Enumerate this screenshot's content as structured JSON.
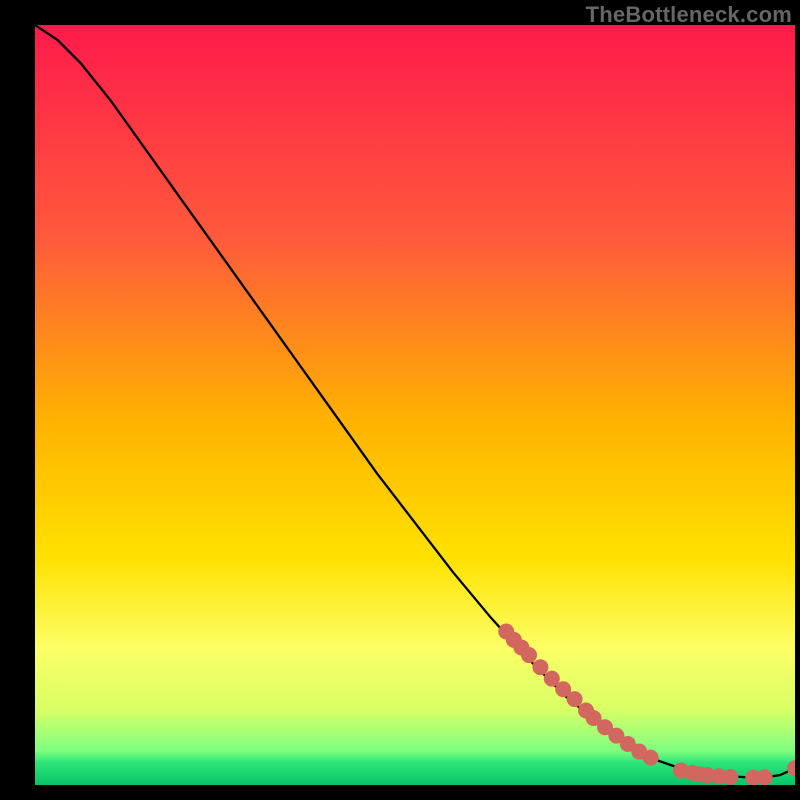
{
  "watermark": "TheBottleneck.com",
  "chart_data": {
    "type": "line",
    "title": "",
    "xlabel": "",
    "ylabel": "",
    "xlim": [
      0,
      100
    ],
    "ylim": [
      0,
      100
    ],
    "gradient_stops": [
      {
        "offset": 0,
        "color": "#ff1a4b"
      },
      {
        "offset": 28,
        "color": "#ff5a3c"
      },
      {
        "offset": 52,
        "color": "#ffb200"
      },
      {
        "offset": 70,
        "color": "#ffe100"
      },
      {
        "offset": 82,
        "color": "#fcff66"
      },
      {
        "offset": 90,
        "color": "#d9ff66"
      },
      {
        "offset": 95.5,
        "color": "#7fff7f"
      },
      {
        "offset": 97,
        "color": "#2fe57a"
      },
      {
        "offset": 100,
        "color": "#06c467"
      }
    ],
    "series": [
      {
        "name": "bottleneck-curve",
        "x": [
          0,
          3,
          6,
          10,
          15,
          20,
          25,
          30,
          35,
          40,
          45,
          50,
          55,
          60,
          65,
          70,
          75,
          78,
          80,
          82,
          84,
          86,
          88,
          90,
          92,
          94,
          96,
          98,
          100
        ],
        "y": [
          100,
          98,
          95,
          90,
          83,
          76,
          69,
          62,
          55,
          48,
          41,
          34.5,
          28,
          22,
          16.5,
          11.5,
          7.5,
          5.5,
          4.2,
          3.2,
          2.5,
          1.9,
          1.5,
          1.2,
          1.1,
          1.0,
          1.0,
          1.3,
          2.2
        ]
      }
    ],
    "markers": {
      "name": "highlight-points",
      "color": "#d1675e",
      "radius": 8,
      "points": [
        {
          "x": 62,
          "y": 20.2
        },
        {
          "x": 63,
          "y": 19.1
        },
        {
          "x": 64,
          "y": 18.1
        },
        {
          "x": 65,
          "y": 17.1
        },
        {
          "x": 66.5,
          "y": 15.5
        },
        {
          "x": 68,
          "y": 14.0
        },
        {
          "x": 69.5,
          "y": 12.6
        },
        {
          "x": 71,
          "y": 11.3
        },
        {
          "x": 72.5,
          "y": 9.8
        },
        {
          "x": 73.5,
          "y": 8.8
        },
        {
          "x": 75,
          "y": 7.6
        },
        {
          "x": 76.5,
          "y": 6.5
        },
        {
          "x": 78,
          "y": 5.4
        },
        {
          "x": 79.5,
          "y": 4.4
        },
        {
          "x": 81,
          "y": 3.6
        },
        {
          "x": 85,
          "y": 1.9
        },
        {
          "x": 86.5,
          "y": 1.6
        },
        {
          "x": 87.5,
          "y": 1.4
        },
        {
          "x": 88.5,
          "y": 1.3
        },
        {
          "x": 90,
          "y": 1.15
        },
        {
          "x": 91.5,
          "y": 1.05
        },
        {
          "x": 94.5,
          "y": 0.95
        },
        {
          "x": 96,
          "y": 1.0
        },
        {
          "x": 100,
          "y": 2.2
        }
      ]
    }
  }
}
